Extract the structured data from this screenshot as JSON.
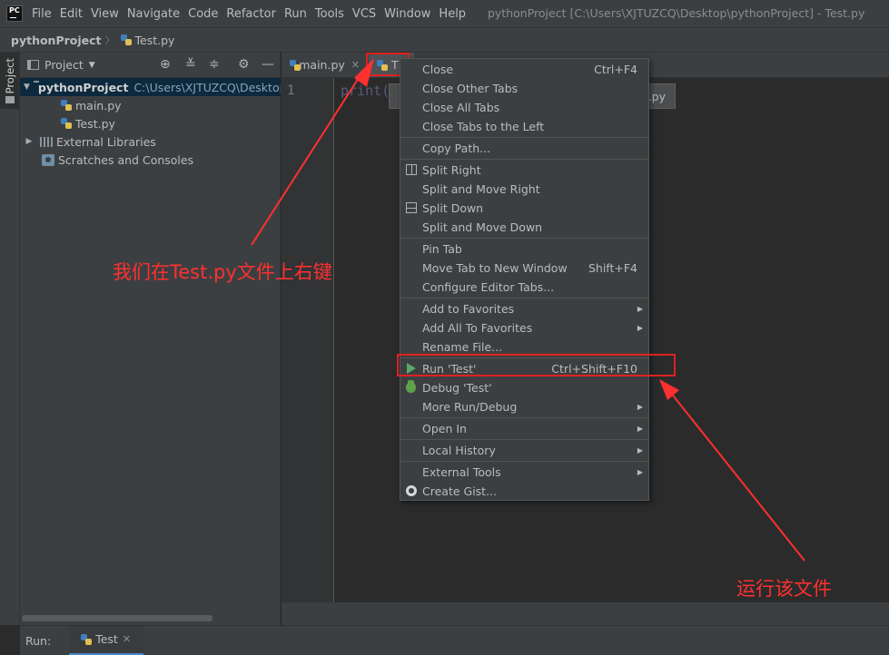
{
  "app": {
    "logo_text": "PC",
    "window_title": "pythonProject [C:\\Users\\XJTUZCQ\\Desktop\\pythonProject] - Test.py"
  },
  "menubar": [
    "File",
    "Edit",
    "View",
    "Navigate",
    "Code",
    "Refactor",
    "Run",
    "Tools",
    "VCS",
    "Window",
    "Help"
  ],
  "breadcrumb": {
    "project": "pythonProject",
    "file": "Test.py"
  },
  "left_strip": {
    "project_tab": "Project"
  },
  "project_panel": {
    "title": "Project",
    "tree": {
      "root_name": "pythonProject",
      "root_path": "C:\\Users\\XJTUZCQ\\Desktop",
      "files": [
        "main.py",
        "Test.py"
      ],
      "external_libraries": "External Libraries",
      "scratches": "Scratches and Consoles"
    }
  },
  "editor": {
    "tabs": [
      {
        "label": "main.py"
      },
      {
        "label": "T"
      }
    ],
    "line_number": "1",
    "code": "print(",
    "tooltip_tail": ".py"
  },
  "context_menu": {
    "items": [
      {
        "label": "Close",
        "shortcut": "Ctrl+F4"
      },
      {
        "label": "Close Other Tabs"
      },
      {
        "label": "Close All Tabs"
      },
      {
        "label": "Close Tabs to the Left"
      },
      {
        "label": "Copy Path..."
      },
      {
        "label": "Split Right",
        "icon": "split-right-icon"
      },
      {
        "label": "Split and Move Right"
      },
      {
        "label": "Split Down",
        "icon": "split-down-icon"
      },
      {
        "label": "Split and Move Down"
      },
      {
        "label": "Pin Tab"
      },
      {
        "label": "Move Tab to New Window",
        "shortcut": "Shift+F4"
      },
      {
        "label": "Configure Editor Tabs..."
      },
      {
        "label": "Add to Favorites",
        "submenu": true
      },
      {
        "label": "Add All To Favorites",
        "submenu": true
      },
      {
        "label": "Rename File..."
      },
      {
        "label": "Run 'Test'",
        "shortcut": "Ctrl+Shift+F10",
        "icon": "run-icon"
      },
      {
        "label": "Debug 'Test'",
        "icon": "debug-icon"
      },
      {
        "label": "More Run/Debug",
        "submenu": true
      },
      {
        "label": "Open In",
        "submenu": true
      },
      {
        "label": "Local History",
        "submenu": true
      },
      {
        "label": "External Tools",
        "submenu": true
      },
      {
        "label": "Create Gist...",
        "icon": "github-icon"
      }
    ]
  },
  "run_bar": {
    "label": "Run:",
    "tab": "Test"
  },
  "annotations": {
    "left": "我们在Test.py文件上右键",
    "right": "运行该文件",
    "color": "#ff3030"
  }
}
